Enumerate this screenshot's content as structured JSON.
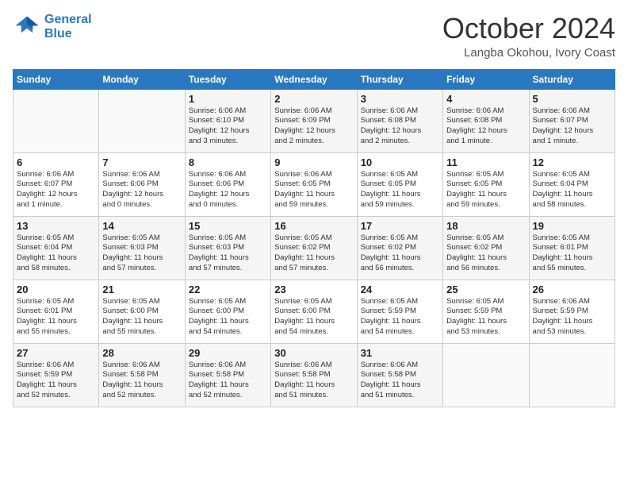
{
  "header": {
    "logo_line1": "General",
    "logo_line2": "Blue",
    "month": "October 2024",
    "location": "Langba Okohou, Ivory Coast"
  },
  "weekdays": [
    "Sunday",
    "Monday",
    "Tuesday",
    "Wednesday",
    "Thursday",
    "Friday",
    "Saturday"
  ],
  "weeks": [
    [
      {
        "day": "",
        "content": ""
      },
      {
        "day": "",
        "content": ""
      },
      {
        "day": "1",
        "content": "Sunrise: 6:06 AM\nSunset: 6:10 PM\nDaylight: 12 hours\nand 3 minutes."
      },
      {
        "day": "2",
        "content": "Sunrise: 6:06 AM\nSunset: 6:09 PM\nDaylight: 12 hours\nand 2 minutes."
      },
      {
        "day": "3",
        "content": "Sunrise: 6:06 AM\nSunset: 6:08 PM\nDaylight: 12 hours\nand 2 minutes."
      },
      {
        "day": "4",
        "content": "Sunrise: 6:06 AM\nSunset: 6:08 PM\nDaylight: 12 hours\nand 1 minute."
      },
      {
        "day": "5",
        "content": "Sunrise: 6:06 AM\nSunset: 6:07 PM\nDaylight: 12 hours\nand 1 minute."
      }
    ],
    [
      {
        "day": "6",
        "content": "Sunrise: 6:06 AM\nSunset: 6:07 PM\nDaylight: 12 hours\nand 1 minute."
      },
      {
        "day": "7",
        "content": "Sunrise: 6:06 AM\nSunset: 6:06 PM\nDaylight: 12 hours\nand 0 minutes."
      },
      {
        "day": "8",
        "content": "Sunrise: 6:06 AM\nSunset: 6:06 PM\nDaylight: 12 hours\nand 0 minutes."
      },
      {
        "day": "9",
        "content": "Sunrise: 6:06 AM\nSunset: 6:05 PM\nDaylight: 11 hours\nand 59 minutes."
      },
      {
        "day": "10",
        "content": "Sunrise: 6:05 AM\nSunset: 6:05 PM\nDaylight: 11 hours\nand 59 minutes."
      },
      {
        "day": "11",
        "content": "Sunrise: 6:05 AM\nSunset: 6:05 PM\nDaylight: 11 hours\nand 59 minutes."
      },
      {
        "day": "12",
        "content": "Sunrise: 6:05 AM\nSunset: 6:04 PM\nDaylight: 11 hours\nand 58 minutes."
      }
    ],
    [
      {
        "day": "13",
        "content": "Sunrise: 6:05 AM\nSunset: 6:04 PM\nDaylight: 11 hours\nand 58 minutes."
      },
      {
        "day": "14",
        "content": "Sunrise: 6:05 AM\nSunset: 6:03 PM\nDaylight: 11 hours\nand 57 minutes."
      },
      {
        "day": "15",
        "content": "Sunrise: 6:05 AM\nSunset: 6:03 PM\nDaylight: 11 hours\nand 57 minutes."
      },
      {
        "day": "16",
        "content": "Sunrise: 6:05 AM\nSunset: 6:02 PM\nDaylight: 11 hours\nand 57 minutes."
      },
      {
        "day": "17",
        "content": "Sunrise: 6:05 AM\nSunset: 6:02 PM\nDaylight: 11 hours\nand 56 minutes."
      },
      {
        "day": "18",
        "content": "Sunrise: 6:05 AM\nSunset: 6:02 PM\nDaylight: 11 hours\nand 56 minutes."
      },
      {
        "day": "19",
        "content": "Sunrise: 6:05 AM\nSunset: 6:01 PM\nDaylight: 11 hours\nand 55 minutes."
      }
    ],
    [
      {
        "day": "20",
        "content": "Sunrise: 6:05 AM\nSunset: 6:01 PM\nDaylight: 11 hours\nand 55 minutes."
      },
      {
        "day": "21",
        "content": "Sunrise: 6:05 AM\nSunset: 6:00 PM\nDaylight: 11 hours\nand 55 minutes."
      },
      {
        "day": "22",
        "content": "Sunrise: 6:05 AM\nSunset: 6:00 PM\nDaylight: 11 hours\nand 54 minutes."
      },
      {
        "day": "23",
        "content": "Sunrise: 6:05 AM\nSunset: 6:00 PM\nDaylight: 11 hours\nand 54 minutes."
      },
      {
        "day": "24",
        "content": "Sunrise: 6:05 AM\nSunset: 5:59 PM\nDaylight: 11 hours\nand 54 minutes."
      },
      {
        "day": "25",
        "content": "Sunrise: 6:05 AM\nSunset: 5:59 PM\nDaylight: 11 hours\nand 53 minutes."
      },
      {
        "day": "26",
        "content": "Sunrise: 6:06 AM\nSunset: 5:59 PM\nDaylight: 11 hours\nand 53 minutes."
      }
    ],
    [
      {
        "day": "27",
        "content": "Sunrise: 6:06 AM\nSunset: 5:59 PM\nDaylight: 11 hours\nand 52 minutes."
      },
      {
        "day": "28",
        "content": "Sunrise: 6:06 AM\nSunset: 5:58 PM\nDaylight: 11 hours\nand 52 minutes."
      },
      {
        "day": "29",
        "content": "Sunrise: 6:06 AM\nSunset: 5:58 PM\nDaylight: 11 hours\nand 52 minutes."
      },
      {
        "day": "30",
        "content": "Sunrise: 6:06 AM\nSunset: 5:58 PM\nDaylight: 11 hours\nand 51 minutes."
      },
      {
        "day": "31",
        "content": "Sunrise: 6:06 AM\nSunset: 5:58 PM\nDaylight: 11 hours\nand 51 minutes."
      },
      {
        "day": "",
        "content": ""
      },
      {
        "day": "",
        "content": ""
      }
    ]
  ]
}
